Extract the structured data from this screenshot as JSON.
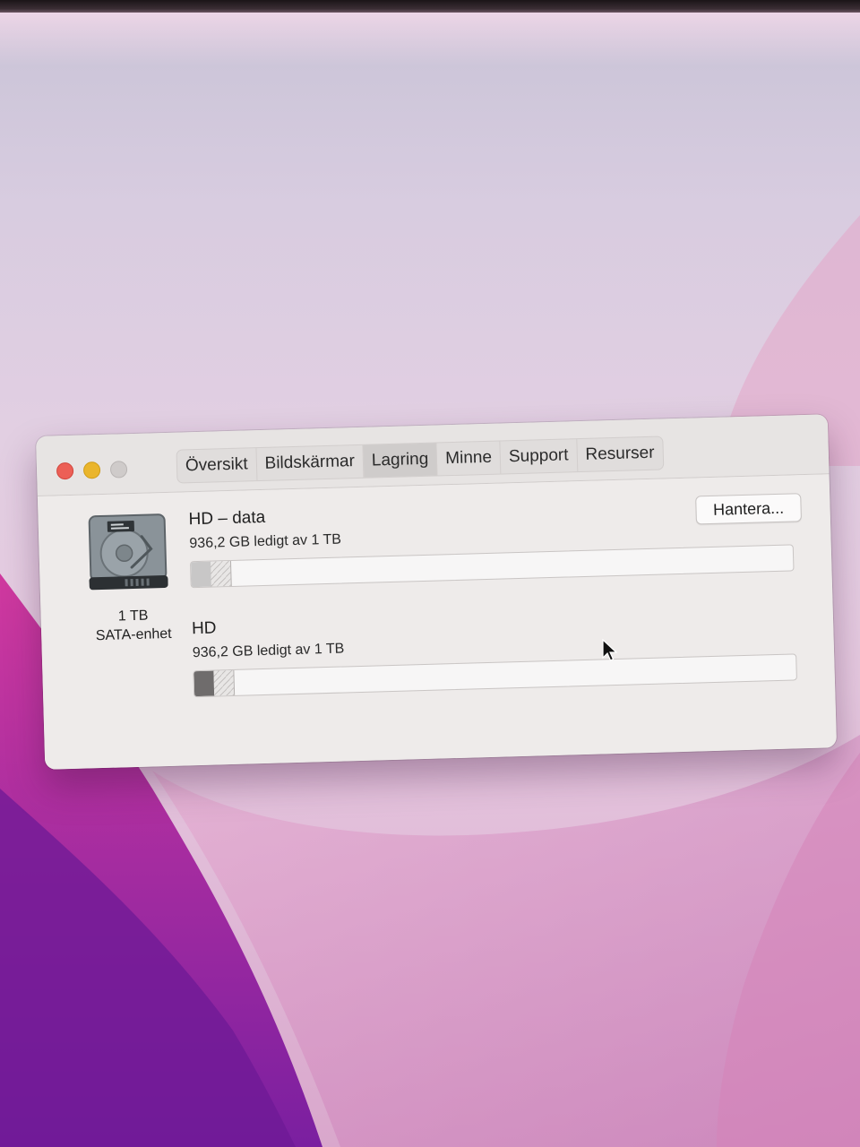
{
  "window": {
    "tabs": [
      {
        "label": "Översikt",
        "active": false
      },
      {
        "label": "Bildskärmar",
        "active": false
      },
      {
        "label": "Lagring",
        "active": true
      },
      {
        "label": "Minne",
        "active": false
      },
      {
        "label": "Support",
        "active": false
      },
      {
        "label": "Resurser",
        "active": false
      }
    ]
  },
  "disk": {
    "icon": "hard-drive-icon",
    "capacity": "1 TB",
    "type": "SATA-enhet"
  },
  "volumes": [
    {
      "name": "HD – data",
      "free_text": "936,2 GB ledigt av 1 TB",
      "used_fraction": 0.032,
      "purgeable_fraction": 0.033,
      "used_color": "#c8c7c7"
    },
    {
      "name": "HD",
      "free_text": "936,2 GB ledigt av 1 TB",
      "used_fraction": 0.032,
      "purgeable_fraction": 0.033,
      "used_color": "#6f6c6c"
    }
  ],
  "buttons": {
    "manage_label": "Hantera..."
  },
  "colors": {
    "close": "#ec5f56",
    "minimize": "#eab52c",
    "zoom": "#cfcbca"
  }
}
